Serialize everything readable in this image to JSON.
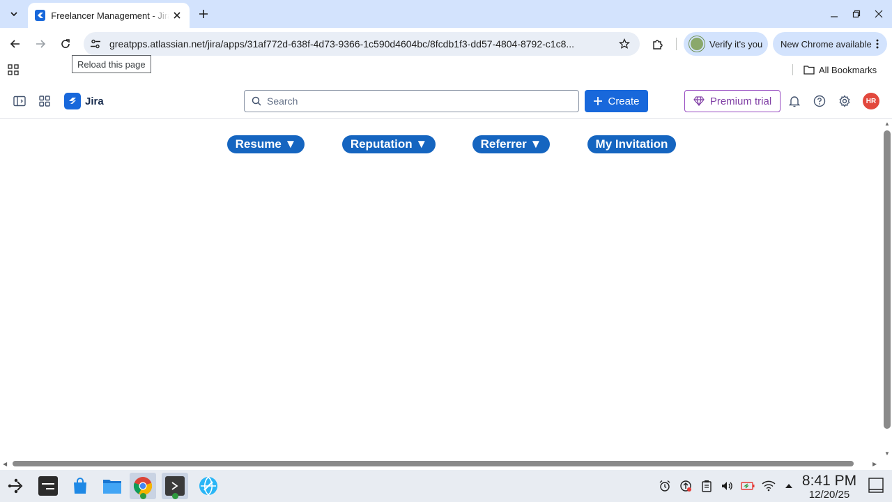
{
  "browser": {
    "tab_title": "Freelancer Management - Jira",
    "url": "greatpps.atlassian.net/jira/apps/31af772d-638f-4d73-9366-1c590d4604bc/8fcdb1f3-dd57-4804-8792-c1c8...",
    "tooltip": "Reload this page",
    "verify_label": "Verify it's you",
    "new_chrome_label": "New Chrome available",
    "bookmarks_label": "All Bookmarks"
  },
  "jira": {
    "app_name": "Jira",
    "search_placeholder": "Search",
    "create_label": "Create",
    "premium_label": "Premium trial",
    "avatar_initials": "HR"
  },
  "app_nav": [
    {
      "label": "Resume ▼"
    },
    {
      "label": "Reputation ▼"
    },
    {
      "label": "Referrer ▼"
    },
    {
      "label": "My Invitation"
    }
  ],
  "taskbar": {
    "time": "8:41 PM",
    "date": "12/20/25"
  },
  "colors": {
    "accent": "#1868db",
    "nav_button": "#1565c0",
    "premium": "#803fa5",
    "avatar": "#e2483d"
  }
}
